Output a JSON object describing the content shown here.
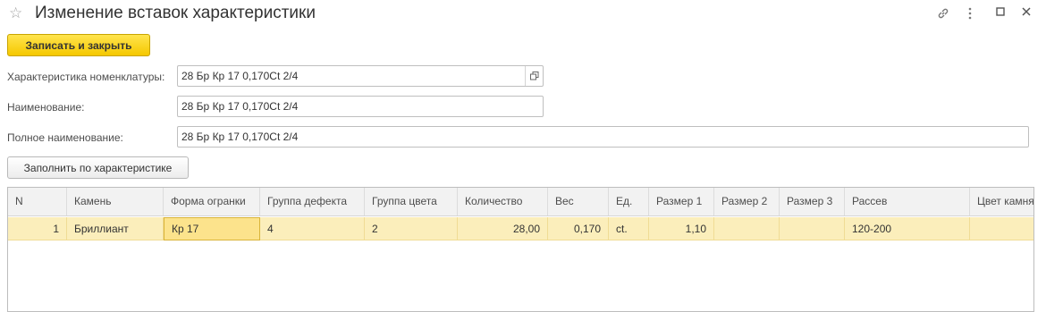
{
  "window": {
    "title": "Изменение вставок характеристики"
  },
  "toolbar": {
    "save_close_label": "Записать и закрыть",
    "fill_label": "Заполнить по характеристике"
  },
  "form": {
    "characteristic_label": "Характеристика номенклатуры:",
    "characteristic_value": "28 Бр Кр 17 0,170Ct 2/4",
    "name_label": "Наименование:",
    "name_value": "28 Бр Кр 17 0,170Ct 2/4",
    "fullname_label": "Полное наименование:",
    "fullname_value": "28 Бр Кр 17 0,170Ct 2/4"
  },
  "table": {
    "columns": [
      "N",
      "Камень",
      "Форма огранки",
      "Группа дефекта",
      "Группа цвета",
      "Количество",
      "Вес",
      "Ед.",
      "Размер 1",
      "Размер 2",
      "Размер 3",
      "Рассев",
      "Цвет камня"
    ],
    "rows": [
      [
        "1",
        "Бриллиант",
        "Кр 17",
        "4",
        "2",
        "28,00",
        "0,170",
        "ct.",
        "1,10",
        "",
        "",
        "120-200",
        ""
      ]
    ]
  },
  "icons": [
    "star-icon",
    "link-icon",
    "more-icon",
    "maximize-icon",
    "close-icon",
    "open-form-icon"
  ],
  "colors": {
    "primary_button": "#f5c800",
    "selected_row": "#fbeebb",
    "active_cell": "#fce38c"
  }
}
